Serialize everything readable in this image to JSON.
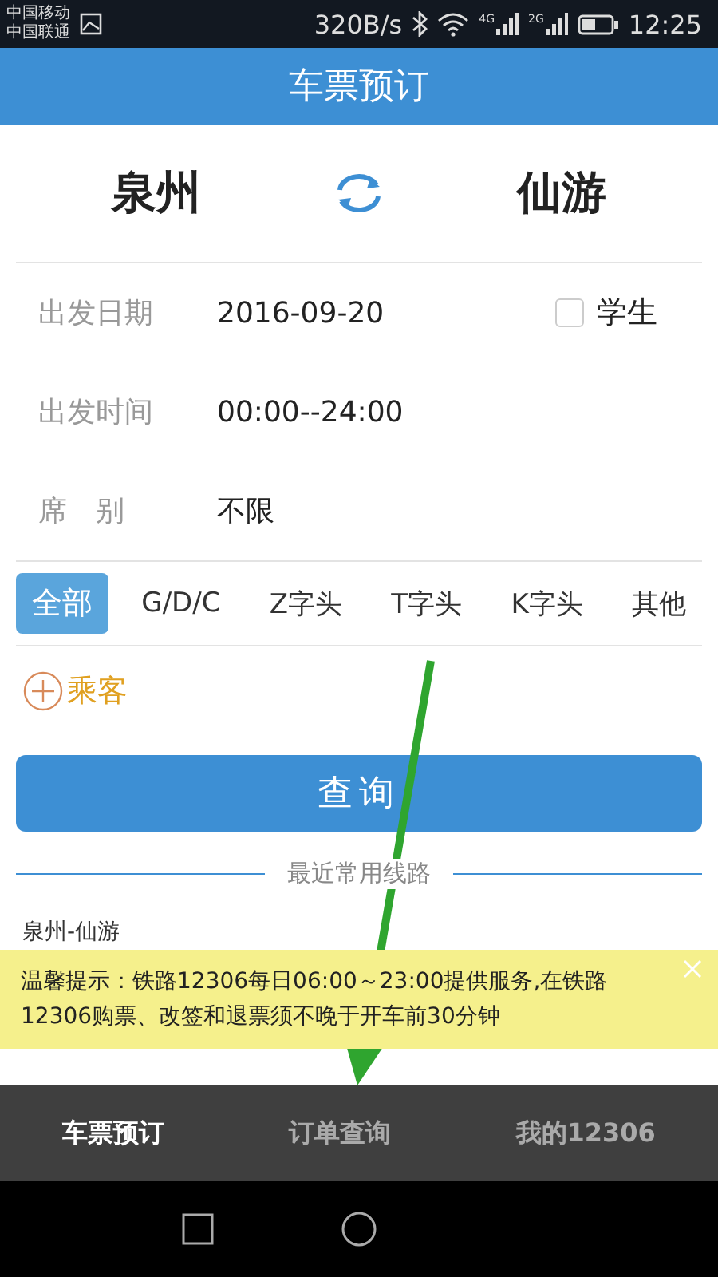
{
  "status_bar": {
    "carriers": [
      "中国移动",
      "中国联通"
    ],
    "speed": "320B/s",
    "network_labels": [
      "4G",
      "2G"
    ],
    "time": "12:25"
  },
  "header": {
    "title": "车票预订"
  },
  "stations": {
    "from": "泉州",
    "to": "仙游"
  },
  "fields": [
    {
      "label": "出发日期",
      "value": "2016-09-20",
      "kind": "date"
    },
    {
      "label": "出发时间",
      "value": "00:00--24:00",
      "kind": "plain"
    },
    {
      "label": "席　别",
      "value": "不限",
      "kind": "plain"
    }
  ],
  "student": {
    "label": "学生",
    "checked": false
  },
  "train_types": [
    {
      "label": "全部",
      "selected": true
    },
    {
      "label": "G/D/C",
      "selected": false
    },
    {
      "label": "Z字头",
      "selected": false
    },
    {
      "label": "T字头",
      "selected": false
    },
    {
      "label": "K字头",
      "selected": false
    },
    {
      "label": "其他",
      "selected": false
    }
  ],
  "passenger": {
    "label": "乘客"
  },
  "query_button": "查询",
  "recent": {
    "title": "最近常用线路",
    "routes": [
      "泉州-仙游"
    ]
  },
  "notice": {
    "text": "温馨提示：铁路12306每日06:00～23:00提供服务,在铁路12306购票、改签和退票须不晚于开车前30分钟"
  },
  "bottom_tabs": [
    {
      "label": "车票预订",
      "selected": true
    },
    {
      "label": "订单查询",
      "selected": false
    },
    {
      "label": "我的12306",
      "selected": false
    }
  ]
}
